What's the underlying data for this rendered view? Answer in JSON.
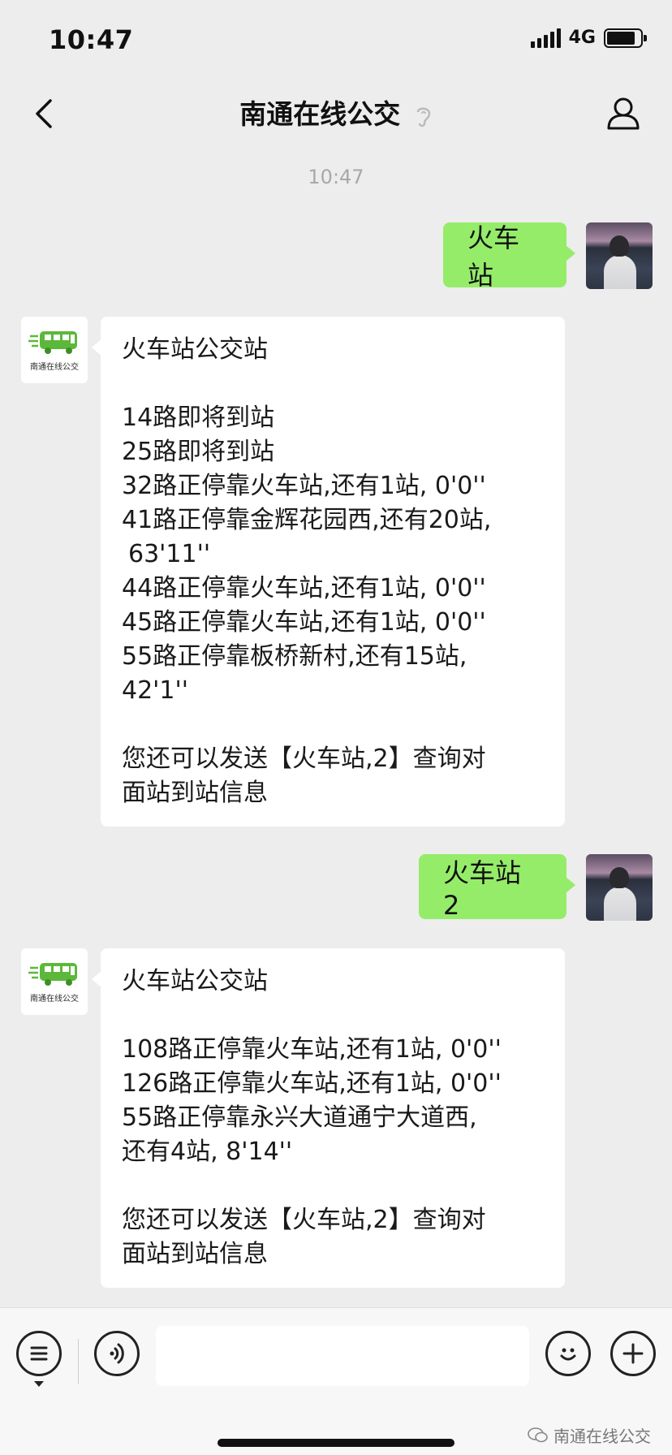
{
  "status_bar": {
    "time": "10:47",
    "network": "4G"
  },
  "nav": {
    "title": "南通在线公交"
  },
  "chat": {
    "time_label": "10:47",
    "bot_logo_text": "南通在线公交",
    "messages": [
      {
        "from": "user",
        "text": "火车站"
      },
      {
        "from": "bot",
        "lines": [
          "火车站公交站",
          "",
          "14路即将到站",
          "25路即将到站",
          "32路正停靠火车站,还有1站, 0'0''",
          "41路正停靠金辉花园西,还有20站,",
          " 63'11''",
          "44路正停靠火车站,还有1站, 0'0''",
          "45路正停靠火车站,还有1站, 0'0''",
          "55路正停靠板桥新村,还有15站,",
          "42'1''",
          "",
          "您还可以发送【火车站,2】查询对",
          "面站到站信息"
        ]
      },
      {
        "from": "user",
        "text": "火车站 2"
      },
      {
        "from": "bot",
        "lines": [
          "火车站公交站",
          "",
          "108路正停靠火车站,还有1站, 0'0''",
          "126路正停靠火车站,还有1站, 0'0''",
          "55路正停靠永兴大道通宁大道西,",
          "还有4站, 8'14''",
          "",
          "您还可以发送【火车站,2】查询对",
          "面站到站信息"
        ]
      }
    ]
  },
  "input_bar": {
    "placeholder": ""
  },
  "watermark": {
    "text": "南通在线公交"
  }
}
